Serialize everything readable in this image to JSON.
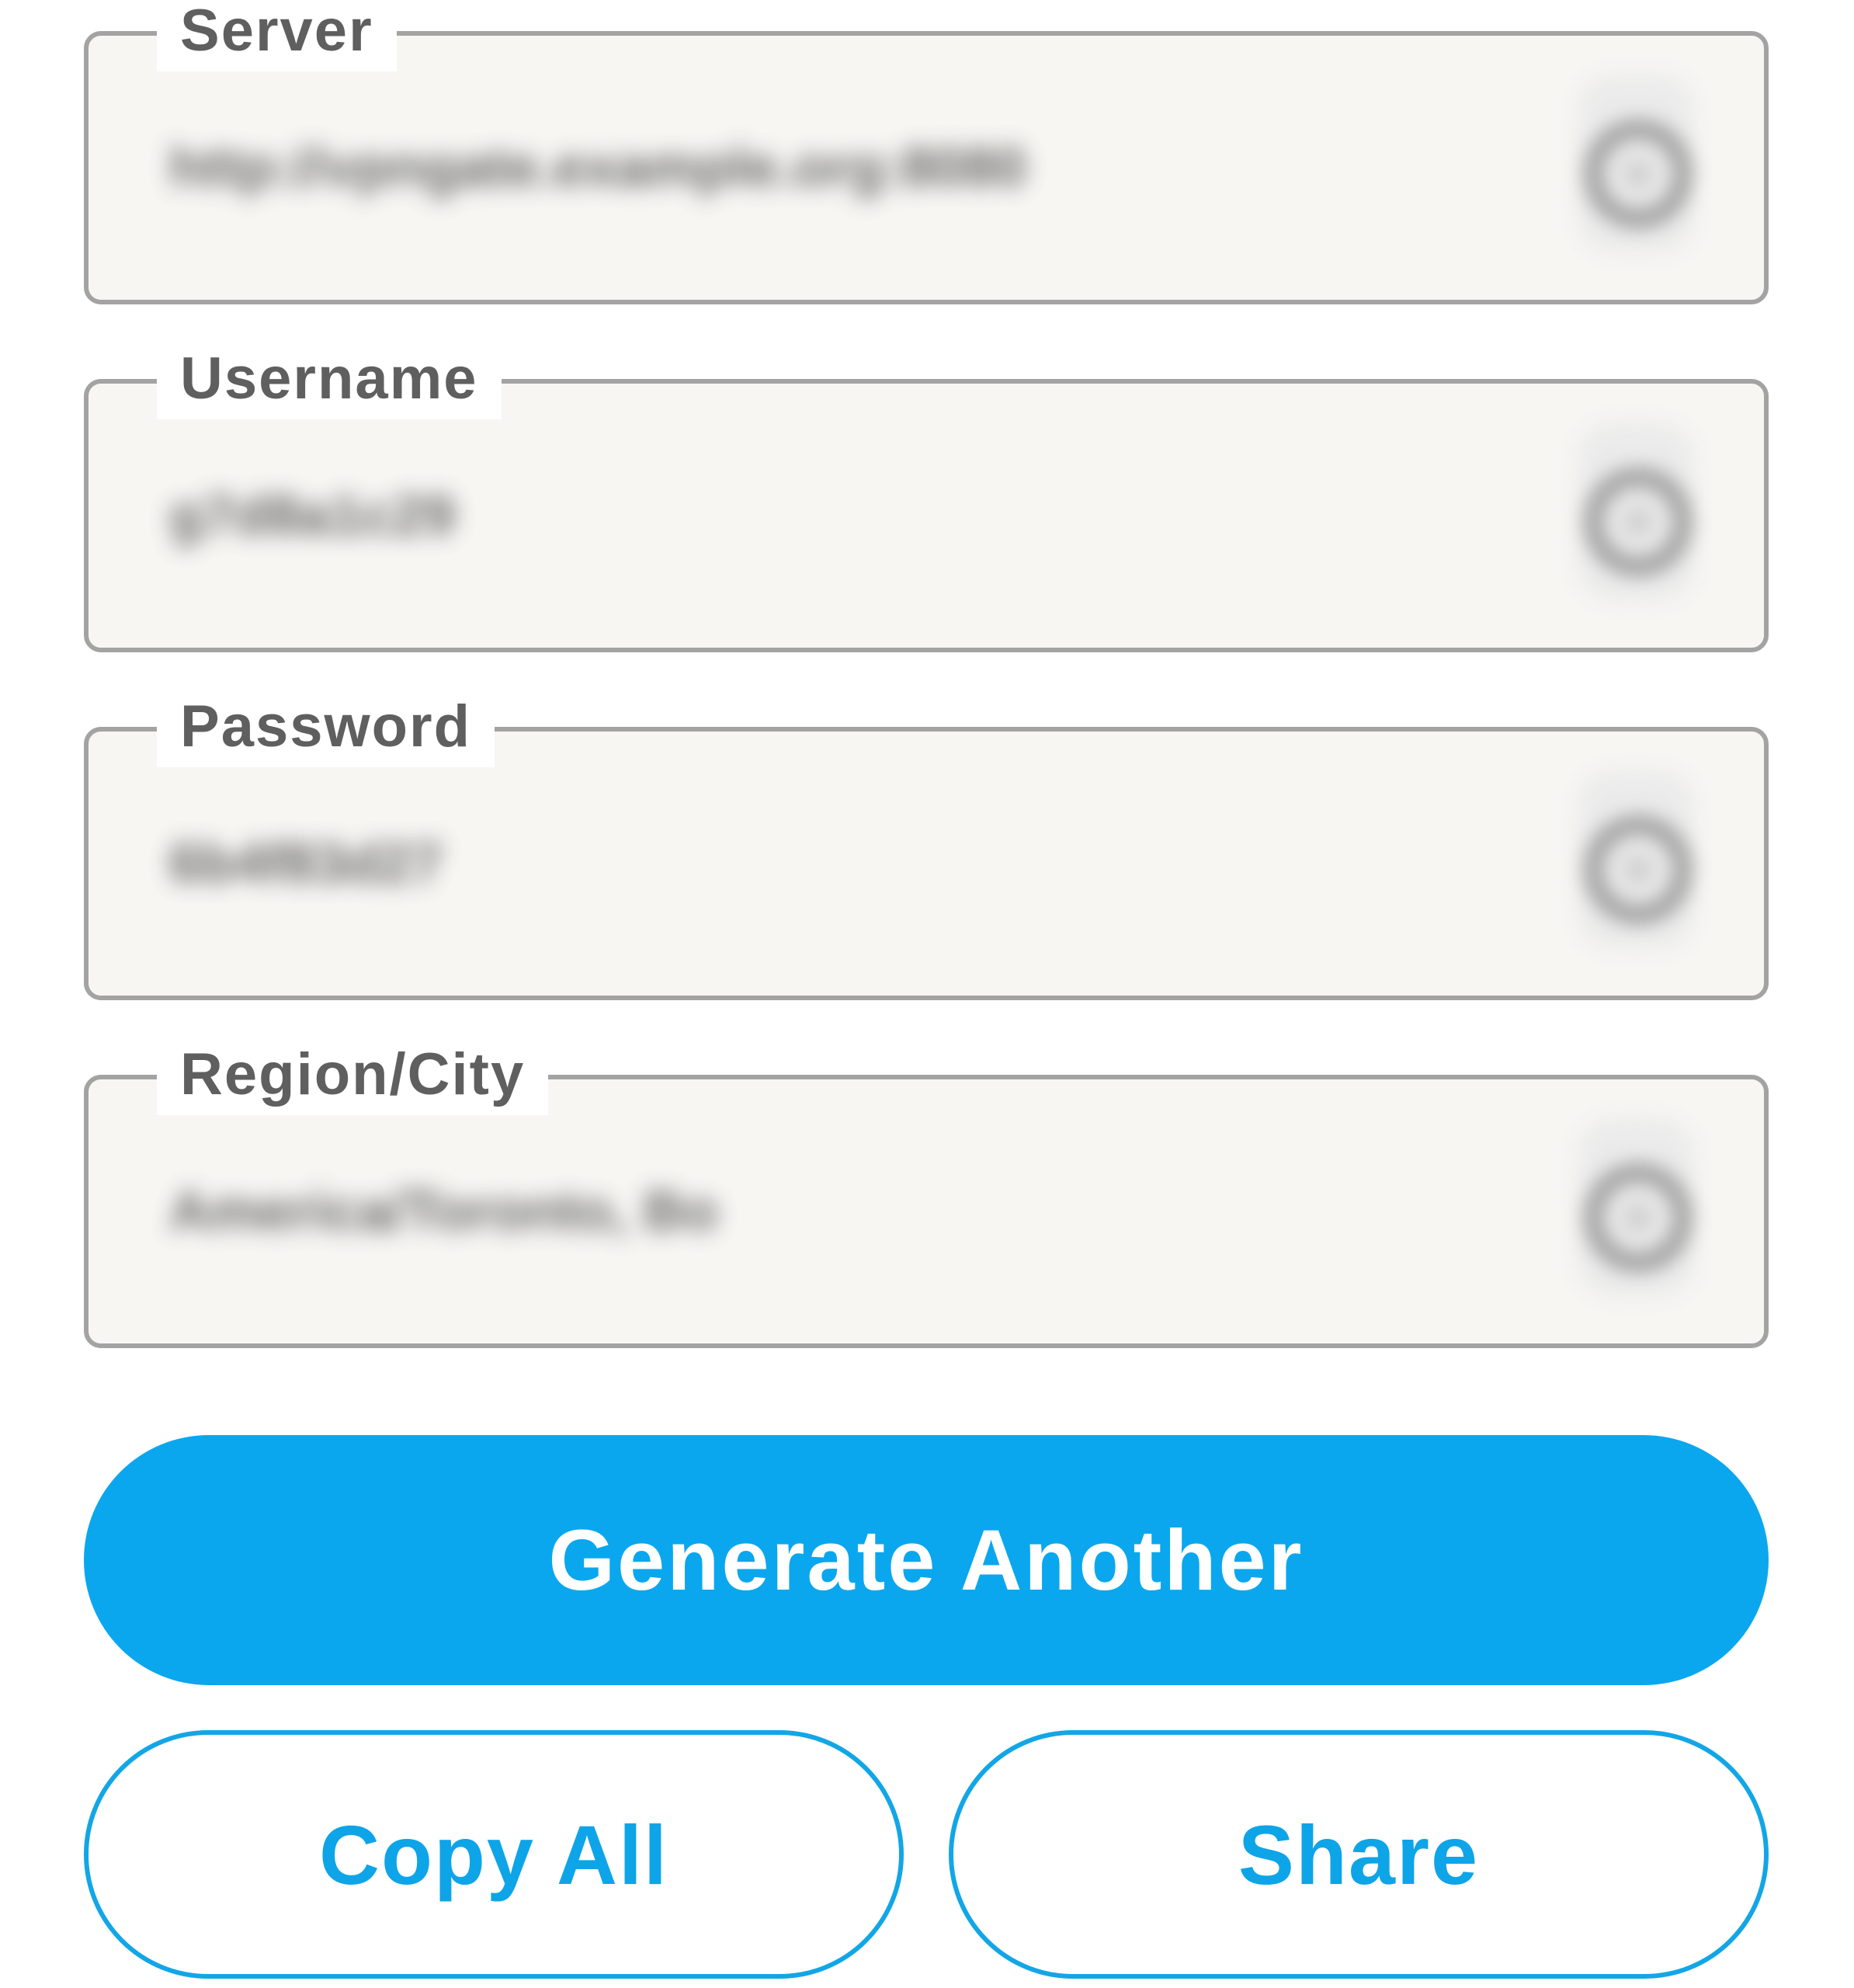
{
  "fields": [
    {
      "label": "Server",
      "value": "http://vpngate.example.org:8080"
    },
    {
      "label": "Username",
      "value": "g7d8a1c29"
    },
    {
      "label": "Password",
      "value": "6b4f83d27"
    },
    {
      "label": "Region/City",
      "value": "America/Toronto, Bo"
    }
  ],
  "actions": {
    "generate_label": "Generate Another",
    "copy_all_label": "Copy All",
    "share_label": "Share"
  },
  "icons": {
    "copy": "copy-icon"
  },
  "colors": {
    "accent": "#0aa7ee",
    "field_border": "#a3a3a3",
    "field_background": "#f7f6f3",
    "label_text": "#5f5f5f"
  }
}
